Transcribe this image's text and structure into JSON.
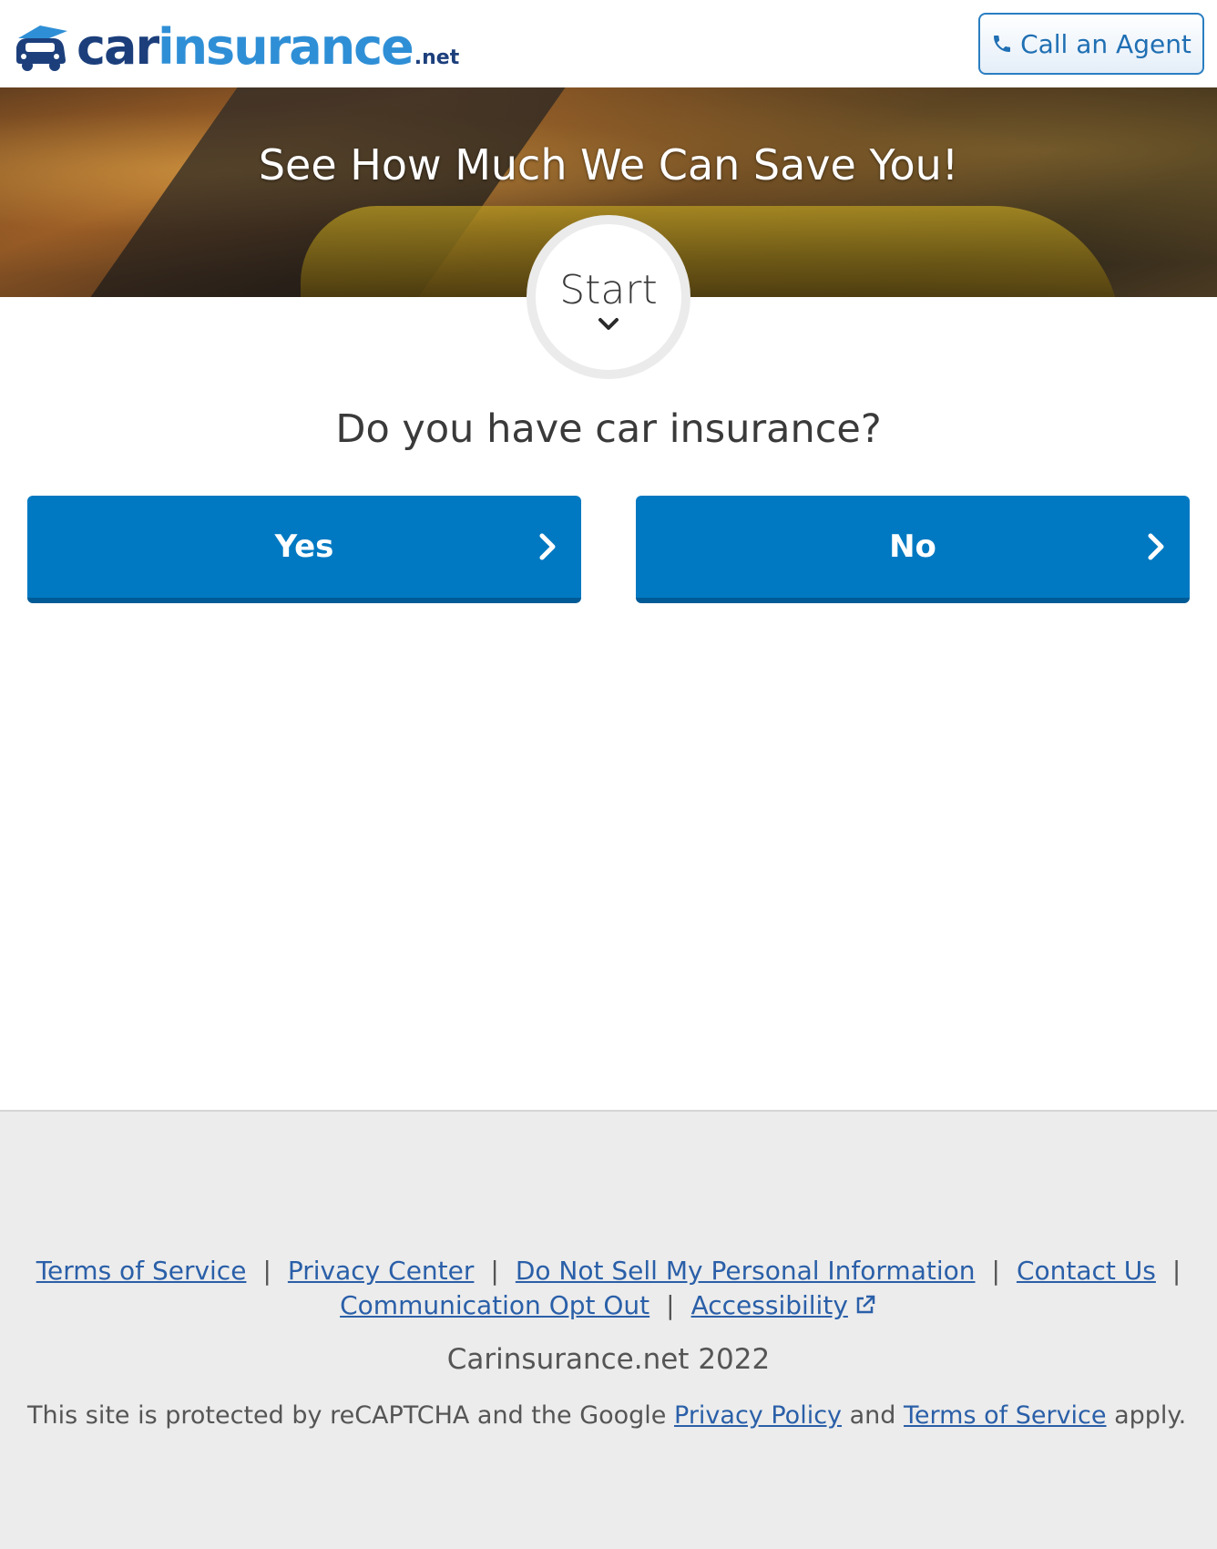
{
  "header": {
    "logo": {
      "car": "car",
      "insurance": "insurance",
      "tld": ".net"
    },
    "call_button_label": "Call an Agent"
  },
  "hero": {
    "title": "See How Much We Can Save You!"
  },
  "start": {
    "label": "Start"
  },
  "question": {
    "text": "Do you have car insurance?",
    "options": [
      "Yes",
      "No"
    ]
  },
  "footer": {
    "links": [
      "Terms of Service",
      "Privacy Center",
      "Do Not Sell My Personal Information",
      "Contact Us",
      "Communication Opt Out",
      "Accessibility"
    ],
    "separator": "|",
    "copyright": "Carinsurance.net 2022",
    "recaptcha": {
      "prefix": "This site is protected by reCAPTCHA and the Google",
      "privacy_link": "Privacy Policy",
      "and": "and",
      "terms_link": "Terms of Service",
      "suffix": "apply."
    }
  },
  "colors": {
    "brand_dark": "#1c3f7c",
    "brand_light": "#2f8fd6",
    "button_blue": "#0079c2",
    "link_blue": "#2a5fa8",
    "footer_bg": "#ececec"
  },
  "icons": {
    "phone": "phone-icon",
    "chevron_down": "chevron-down-icon",
    "chevron_right": "chevron-right-icon",
    "external_link": "external-link-icon",
    "logo_car": "car-logo-icon"
  }
}
